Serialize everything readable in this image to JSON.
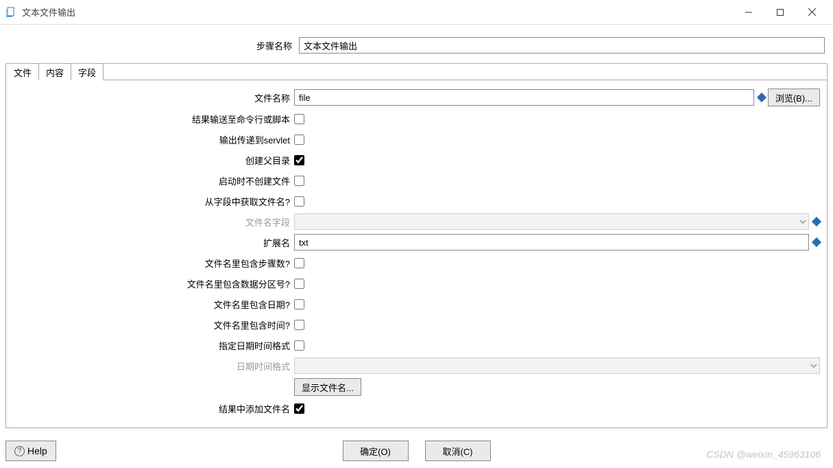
{
  "window": {
    "title": "文本文件输出"
  },
  "stepName": {
    "label": "步骤名称",
    "value": "文本文件输出"
  },
  "tabs": {
    "file": "文件",
    "content": "内容",
    "fields": "字段"
  },
  "form": {
    "filename_label": "文件名称",
    "filename_value": "file",
    "browse_button": "浏览(B)...",
    "result_to_cmd_label": "结果输送至命令行或脚本",
    "output_servlet_label": "输出传递到servlet",
    "create_parent_label": "创建父目录",
    "no_create_start_label": "启动时不创建文件",
    "filename_from_field_label": "从字段中获取文件名?",
    "filename_field_label": "文件名字段",
    "extension_label": "扩展名",
    "extension_value": "txt",
    "include_step_label": "文件名里包含步骤数?",
    "include_partition_label": "文件名里包含数据分区号?",
    "include_date_label": "文件名里包含日期?",
    "include_time_label": "文件名里包含时间?",
    "specify_dt_format_label": "指定日期时间格式",
    "dt_format_label": "日期时间格式",
    "show_filename_button": "显示文件名...",
    "add_filename_result_label": "结果中添加文件名"
  },
  "buttons": {
    "help": "Help",
    "ok": "确定(O)",
    "cancel": "取消(C)"
  },
  "watermark": "CSDN @weixin_45963106"
}
